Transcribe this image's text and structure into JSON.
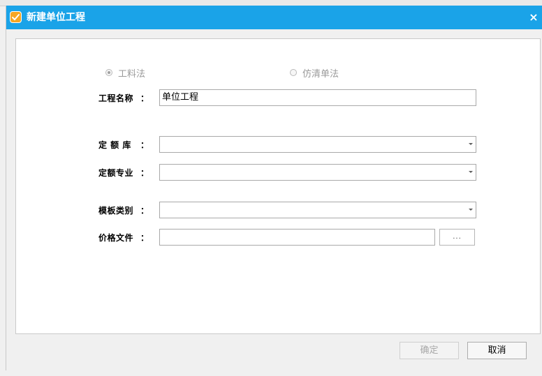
{
  "window": {
    "title": "新建单位工程",
    "close_glyph": "×"
  },
  "calc_method": {
    "option_labor": "工料法",
    "option_unit_price": "仿清单法",
    "selected": "工料法"
  },
  "form": {
    "project_name_label": "工程名称",
    "project_name_value": "单位工程",
    "quota_lib_label": "定 额 库",
    "quota_lib_value": "",
    "quota_specialty_label": "定额专业",
    "quota_specialty_value": "",
    "template_category_label": "模板类别",
    "template_category_value": "",
    "price_file_label": "价格文件",
    "price_file_value": "",
    "colon": "：",
    "browse_label": "..."
  },
  "buttons": {
    "ok": "确定",
    "cancel": "取消"
  },
  "icons": {
    "app": "app-logo-icon",
    "close": "close-icon",
    "dropdown": "chevron-down-icon"
  },
  "colors": {
    "titlebar": "#1aa3e8",
    "disabled_text": "#a8a8a8"
  }
}
